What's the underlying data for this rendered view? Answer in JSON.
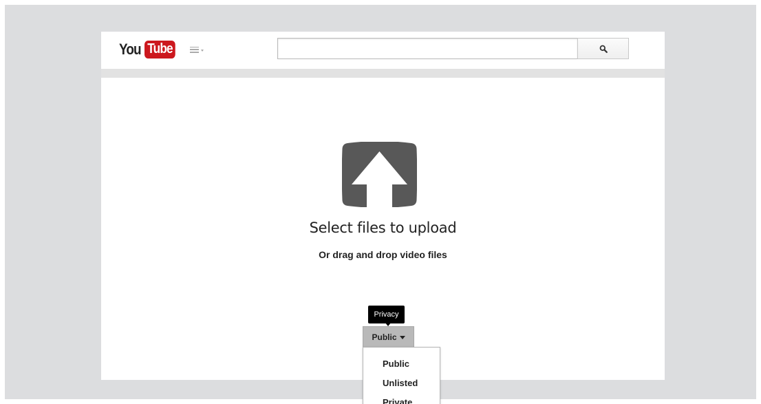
{
  "logo": {
    "part1": "You",
    "part2": "Tube",
    "brand_color": "#cc181e"
  },
  "guide": {
    "icon": "hamburger-menu-icon"
  },
  "search": {
    "value": "",
    "placeholder": "",
    "button_icon": "search-icon"
  },
  "upload": {
    "icon": "upload-arrow-icon",
    "title": "Select files to upload",
    "subtitle": "Or drag and drop video files"
  },
  "privacy": {
    "tooltip": "Privacy",
    "selected": "Public",
    "options": [
      "Public",
      "Unlisted",
      "Private"
    ]
  }
}
